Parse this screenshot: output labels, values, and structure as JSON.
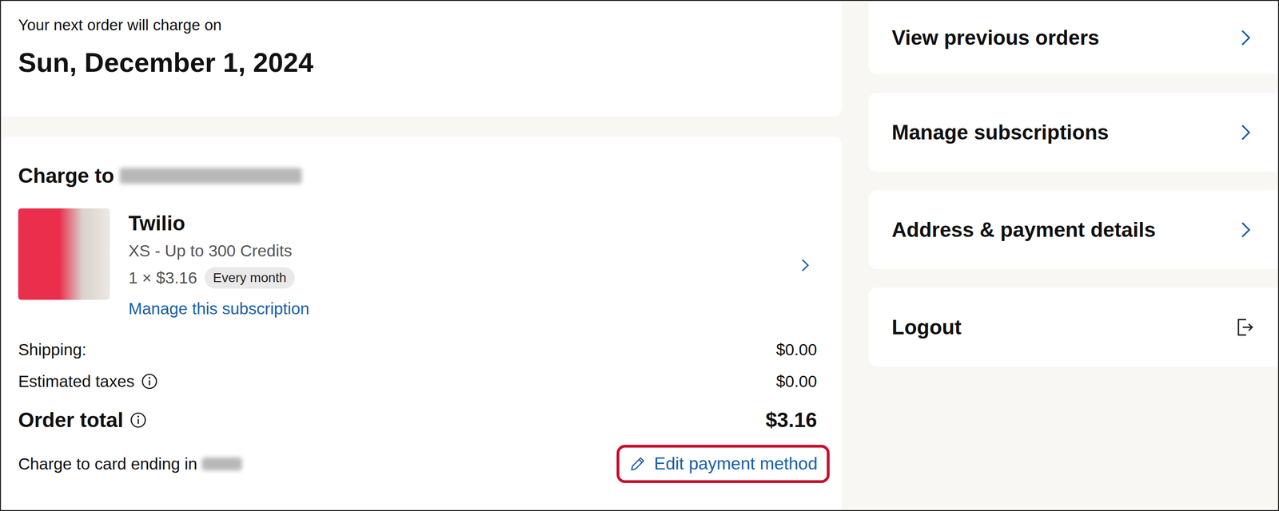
{
  "next_charge": {
    "label": "Your next order will charge on",
    "date": "Sun, December 1, 2024"
  },
  "order": {
    "charge_to_label": "Charge to",
    "items": [
      {
        "name": "Twilio",
        "variant": "XS - Up to 300 Credits",
        "quantity_price": "1 × $3.16",
        "frequency": "Every month",
        "manage_link": "Manage this subscription"
      }
    ],
    "summary": [
      {
        "label": "Shipping:",
        "value": "$0.00",
        "info": false
      },
      {
        "label": "Estimated taxes",
        "value": "$0.00",
        "info": true
      }
    ],
    "total": {
      "label": "Order total",
      "value": "$3.16",
      "info": true
    },
    "payment": {
      "label": "Charge to card ending in",
      "action": "Edit payment method",
      "highlighted": true
    }
  },
  "menu": [
    {
      "label": "View previous orders",
      "kind": "link"
    },
    {
      "label": "Manage subscriptions",
      "kind": "link"
    },
    {
      "label": "Address & payment details",
      "kind": "link"
    },
    {
      "label": "Logout",
      "kind": "logout"
    }
  ]
}
